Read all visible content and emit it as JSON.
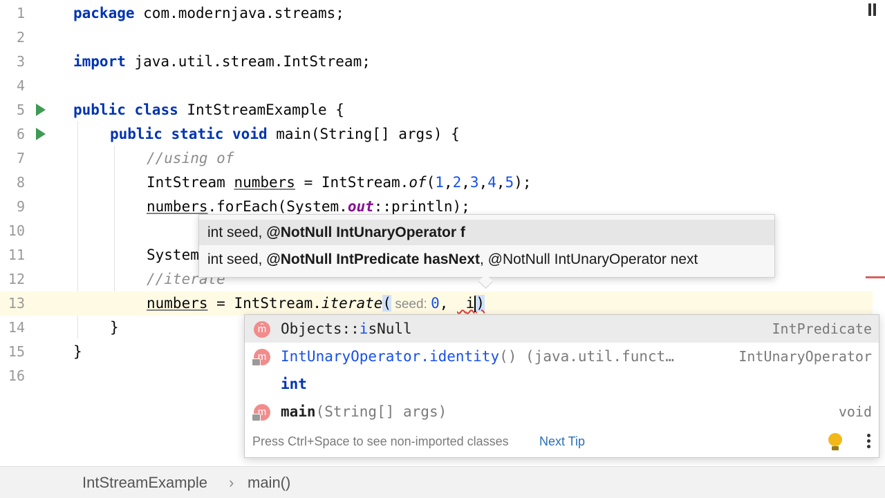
{
  "editor": {
    "lines": [
      {
        "num": "1",
        "tokens": [
          {
            "text": "package",
            "cls": "kw"
          },
          {
            "text": " com.modernjava.streams;"
          }
        ]
      },
      {
        "num": "2",
        "tokens": []
      },
      {
        "num": "3",
        "tokens": [
          {
            "text": "import",
            "cls": "kw"
          },
          {
            "text": " java.util.stream.IntStream;"
          }
        ]
      },
      {
        "num": "4",
        "tokens": []
      },
      {
        "num": "5",
        "run": true,
        "tokens": [
          {
            "text": "public",
            "cls": "kw"
          },
          {
            "text": " "
          },
          {
            "text": "class",
            "cls": "kw"
          },
          {
            "text": " IntStreamExample {"
          }
        ]
      },
      {
        "num": "6",
        "run": true,
        "indent": 1,
        "tokens": [
          {
            "text": "public",
            "cls": "kw"
          },
          {
            "text": " "
          },
          {
            "text": "static",
            "cls": "kw"
          },
          {
            "text": " "
          },
          {
            "text": "void",
            "cls": "kw"
          },
          {
            "text": " main(String[] args) {"
          }
        ]
      },
      {
        "num": "7",
        "indent": 2,
        "tokens": [
          {
            "text": "//using of",
            "cls": "cm"
          }
        ]
      },
      {
        "num": "8",
        "indent": 2,
        "tokens": [
          {
            "text": "IntStream "
          },
          {
            "text": "numbers",
            "cls": "ul"
          },
          {
            "text": " = IntStream."
          },
          {
            "text": "of",
            "cls": "it"
          },
          {
            "text": "("
          },
          {
            "text": "1",
            "cls": "num"
          },
          {
            "text": ","
          },
          {
            "text": "2",
            "cls": "num"
          },
          {
            "text": ","
          },
          {
            "text": "3",
            "cls": "num"
          },
          {
            "text": ","
          },
          {
            "text": "4",
            "cls": "num"
          },
          {
            "text": ","
          },
          {
            "text": "5",
            "cls": "num"
          },
          {
            "text": ");"
          }
        ]
      },
      {
        "num": "9",
        "indent": 2,
        "tokens": [
          {
            "text": "numbers",
            "cls": "ul"
          },
          {
            "text": ".forEach(System."
          },
          {
            "text": "out",
            "cls": "sf"
          },
          {
            "text": "::println);"
          }
        ]
      },
      {
        "num": "10",
        "tokens": []
      },
      {
        "num": "11",
        "indent": 2,
        "tokens": [
          {
            "text": "System"
          }
        ]
      },
      {
        "num": "12",
        "indent": 2,
        "tokens": [
          {
            "text": "//iterate",
            "cls": "cm"
          }
        ]
      },
      {
        "num": "13",
        "indent": 2,
        "current": true,
        "tokens": [
          {
            "text": "numbers",
            "cls": "ul"
          },
          {
            "text": " = IntStream."
          },
          {
            "text": "iterate",
            "cls": "it"
          },
          {
            "text": "(",
            "cls": "brace"
          },
          {
            "text": " seed: ",
            "cls": "hint"
          },
          {
            "text": "0",
            "cls": "num"
          },
          {
            "text": ", "
          },
          {
            "text": " ",
            "cls": "err"
          },
          {
            "text": "i",
            "cls": "err"
          },
          {
            "caret": true
          },
          {
            "text": ")",
            "cls": "brace err"
          }
        ]
      },
      {
        "num": "14",
        "indent": 1,
        "tokens": [
          {
            "text": "}"
          }
        ]
      },
      {
        "num": "15",
        "tokens": [
          {
            "text": "}"
          }
        ]
      },
      {
        "num": "16",
        "tokens": []
      }
    ]
  },
  "parameter_info": {
    "rows": [
      {
        "plain_before": "int seed, ",
        "bold": "@NotNull IntUnaryOperator f",
        "plain_after": ""
      },
      {
        "plain_before": "int seed, ",
        "bold": "@NotNull IntPredicate hasNext",
        "plain_after": ", @NotNull IntUnaryOperator next"
      }
    ]
  },
  "completion": {
    "items": [
      {
        "icon": "m̂",
        "locked": false,
        "prefix": "Objects::",
        "match": "i",
        "rest": "sNull",
        "detail": "",
        "type": "IntPredicate",
        "selected": true
      },
      {
        "icon": "m",
        "locked": true,
        "prefix": "IntUnaryOperator.",
        "match": "i",
        "rest": "dentity",
        "detail": "() (java.util.funct…",
        "type": "IntUnaryOperator",
        "selected": false
      },
      {
        "icon": "",
        "locked": false,
        "keyword": "int",
        "type": "",
        "selected": false
      },
      {
        "icon": "m",
        "locked": true,
        "prefix": "",
        "match": "main",
        "rest": "",
        "detail": "(String[] args)",
        "type": "void",
        "selected": false
      }
    ],
    "footer_hint": "Press Ctrl+Space to see non-imported classes",
    "next_tip": "Next Tip"
  },
  "breadcrumb": {
    "class_name": "IntStreamExample",
    "method_name": "main()"
  },
  "colors": {
    "keyword": "#0033b3",
    "comment": "#8c8c8c",
    "number": "#1750eb",
    "static_field": "#871094",
    "current_line": "#fffae3",
    "run_icon": "#3f9a54",
    "method_icon": "#f28c8c",
    "link": "#2a6fb5"
  },
  "icons": [
    "run-gutter-icon",
    "method-icon",
    "lock-icon",
    "lightbulb-icon",
    "more-options-icon",
    "pause-icon",
    "chevron-right-icon"
  ]
}
